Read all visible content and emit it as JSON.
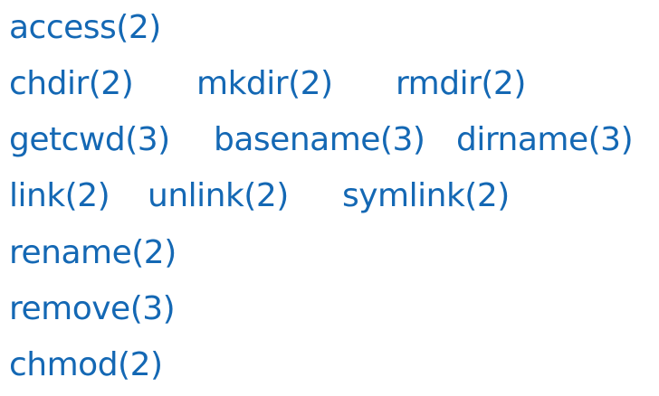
{
  "colors": {
    "text": "#1468b4",
    "background": "#ffffff"
  },
  "rows": [
    {
      "items": [
        "access(2)"
      ]
    },
    {
      "items": [
        "chdir(2)",
        "mkdir(2)",
        "rmdir(2)"
      ]
    },
    {
      "items": [
        "getcwd(3)",
        "basename(3)",
        "dirname(3)"
      ]
    },
    {
      "items": [
        "link(2)",
        "unlink(2)",
        "symlink(2)"
      ]
    },
    {
      "items": [
        "rename(2)"
      ]
    },
    {
      "items": [
        "remove(3)"
      ]
    },
    {
      "items": [
        "chmod(2)"
      ]
    }
  ]
}
